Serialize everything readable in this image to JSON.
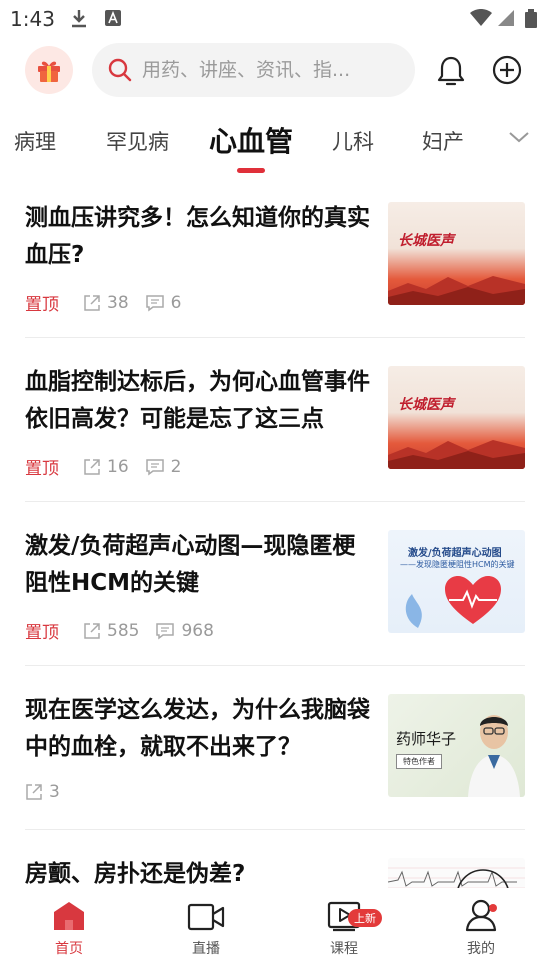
{
  "status_bar": {
    "time": "1:43"
  },
  "search": {
    "placeholder": "用药、讲座、资讯、指..."
  },
  "tabs": [
    "病理",
    "罕见病",
    "心血管",
    "儿科",
    "妇产"
  ],
  "active_tab_index": 2,
  "articles": [
    {
      "title": "测血压讲究多！怎么知道你的真实血压?",
      "pinned": "置顶",
      "shares": "38",
      "comments": "6",
      "thumb": "banner",
      "thumb_text": "长城医声"
    },
    {
      "title": "血脂控制达标后，为何心血管事件依旧高发？可能是忘了这三点",
      "pinned": "置顶",
      "shares": "16",
      "comments": "2",
      "thumb": "banner",
      "thumb_text": "长城医声"
    },
    {
      "title": "激发/负荷超声心动图—现隐匿梗阻性HCM的关键",
      "pinned": "置顶",
      "shares": "585",
      "comments": "968",
      "thumb": "heart",
      "thumb_text": "激发/负荷超声心动图",
      "thumb_subtext": "——发现隐匿梗阻性HCM的关键"
    },
    {
      "title": "现在医学这么发达，为什么我脑袋中的血栓，就取不出来了？",
      "shares": "3",
      "thumb": "pharm",
      "thumb_text": "药师华子",
      "thumb_tag": "特色作者"
    },
    {
      "title": "房颤、房扑还是伪差?",
      "thumb": "ecg"
    }
  ],
  "bottom_nav": [
    {
      "label": "首页",
      "icon": "home-icon",
      "active": true
    },
    {
      "label": "直播",
      "icon": "video-camera-icon"
    },
    {
      "label": "课程",
      "icon": "course-play-icon",
      "badge": "上新"
    },
    {
      "label": "我的",
      "icon": "profile-icon",
      "dot": true
    }
  ],
  "colors": {
    "accent": "#d8383f",
    "search_bg": "#f3f3f3",
    "gift_bg": "#fde8e4"
  }
}
